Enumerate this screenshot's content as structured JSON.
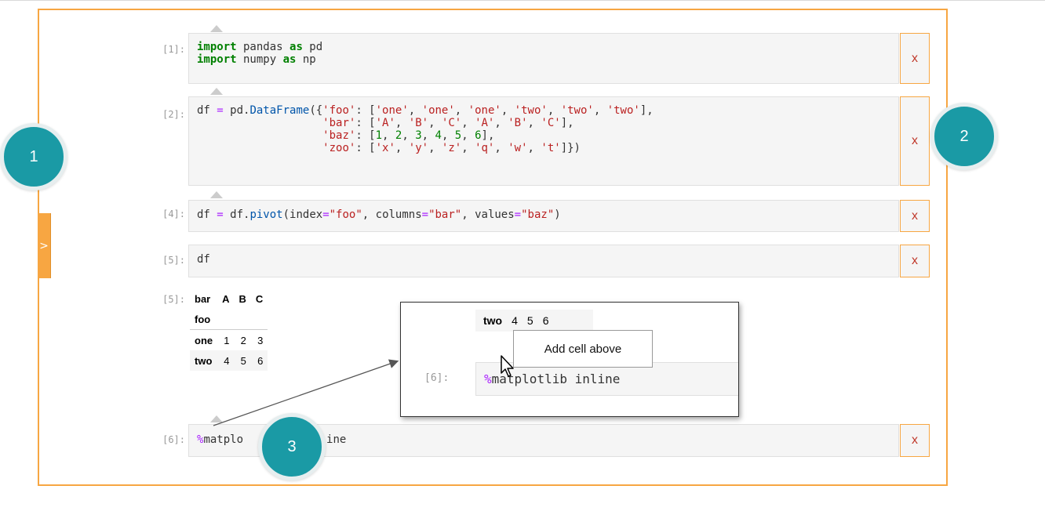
{
  "side_tab": {
    "label": ">"
  },
  "badges": [
    "1",
    "2",
    "3"
  ],
  "cells": [
    {
      "prompt": "[1]:",
      "delete_label": "x"
    },
    {
      "prompt": "[2]:",
      "delete_label": "x"
    },
    {
      "prompt": "[4]:",
      "delete_label": "x"
    },
    {
      "prompt": "[5]:",
      "code": "df",
      "delete_label": "x"
    },
    {
      "prompt": "[6]:",
      "code_magic": "%",
      "code_visible_start": "matplo",
      "code_visible_end": "ine",
      "delete_label": "x"
    }
  ],
  "output": {
    "prompt": "[5]:",
    "columns_name": "bar",
    "columns": [
      "A",
      "B",
      "C"
    ],
    "index_name": "foo",
    "rows": [
      {
        "index": "one",
        "values": [
          "1",
          "2",
          "3"
        ]
      },
      {
        "index": "two",
        "values": [
          "4",
          "5",
          "6"
        ]
      }
    ]
  },
  "zoom": {
    "row": {
      "index": "two",
      "values": [
        "4",
        "5",
        "6"
      ]
    },
    "tooltip": "Add cell above",
    "prompt": "[6]:",
    "code_magic": "%",
    "code_rest": "matplotlib inline"
  },
  "colors": {
    "accent": "#f7a642",
    "badge": "#1a9aa5",
    "delete": "#c0392b"
  }
}
